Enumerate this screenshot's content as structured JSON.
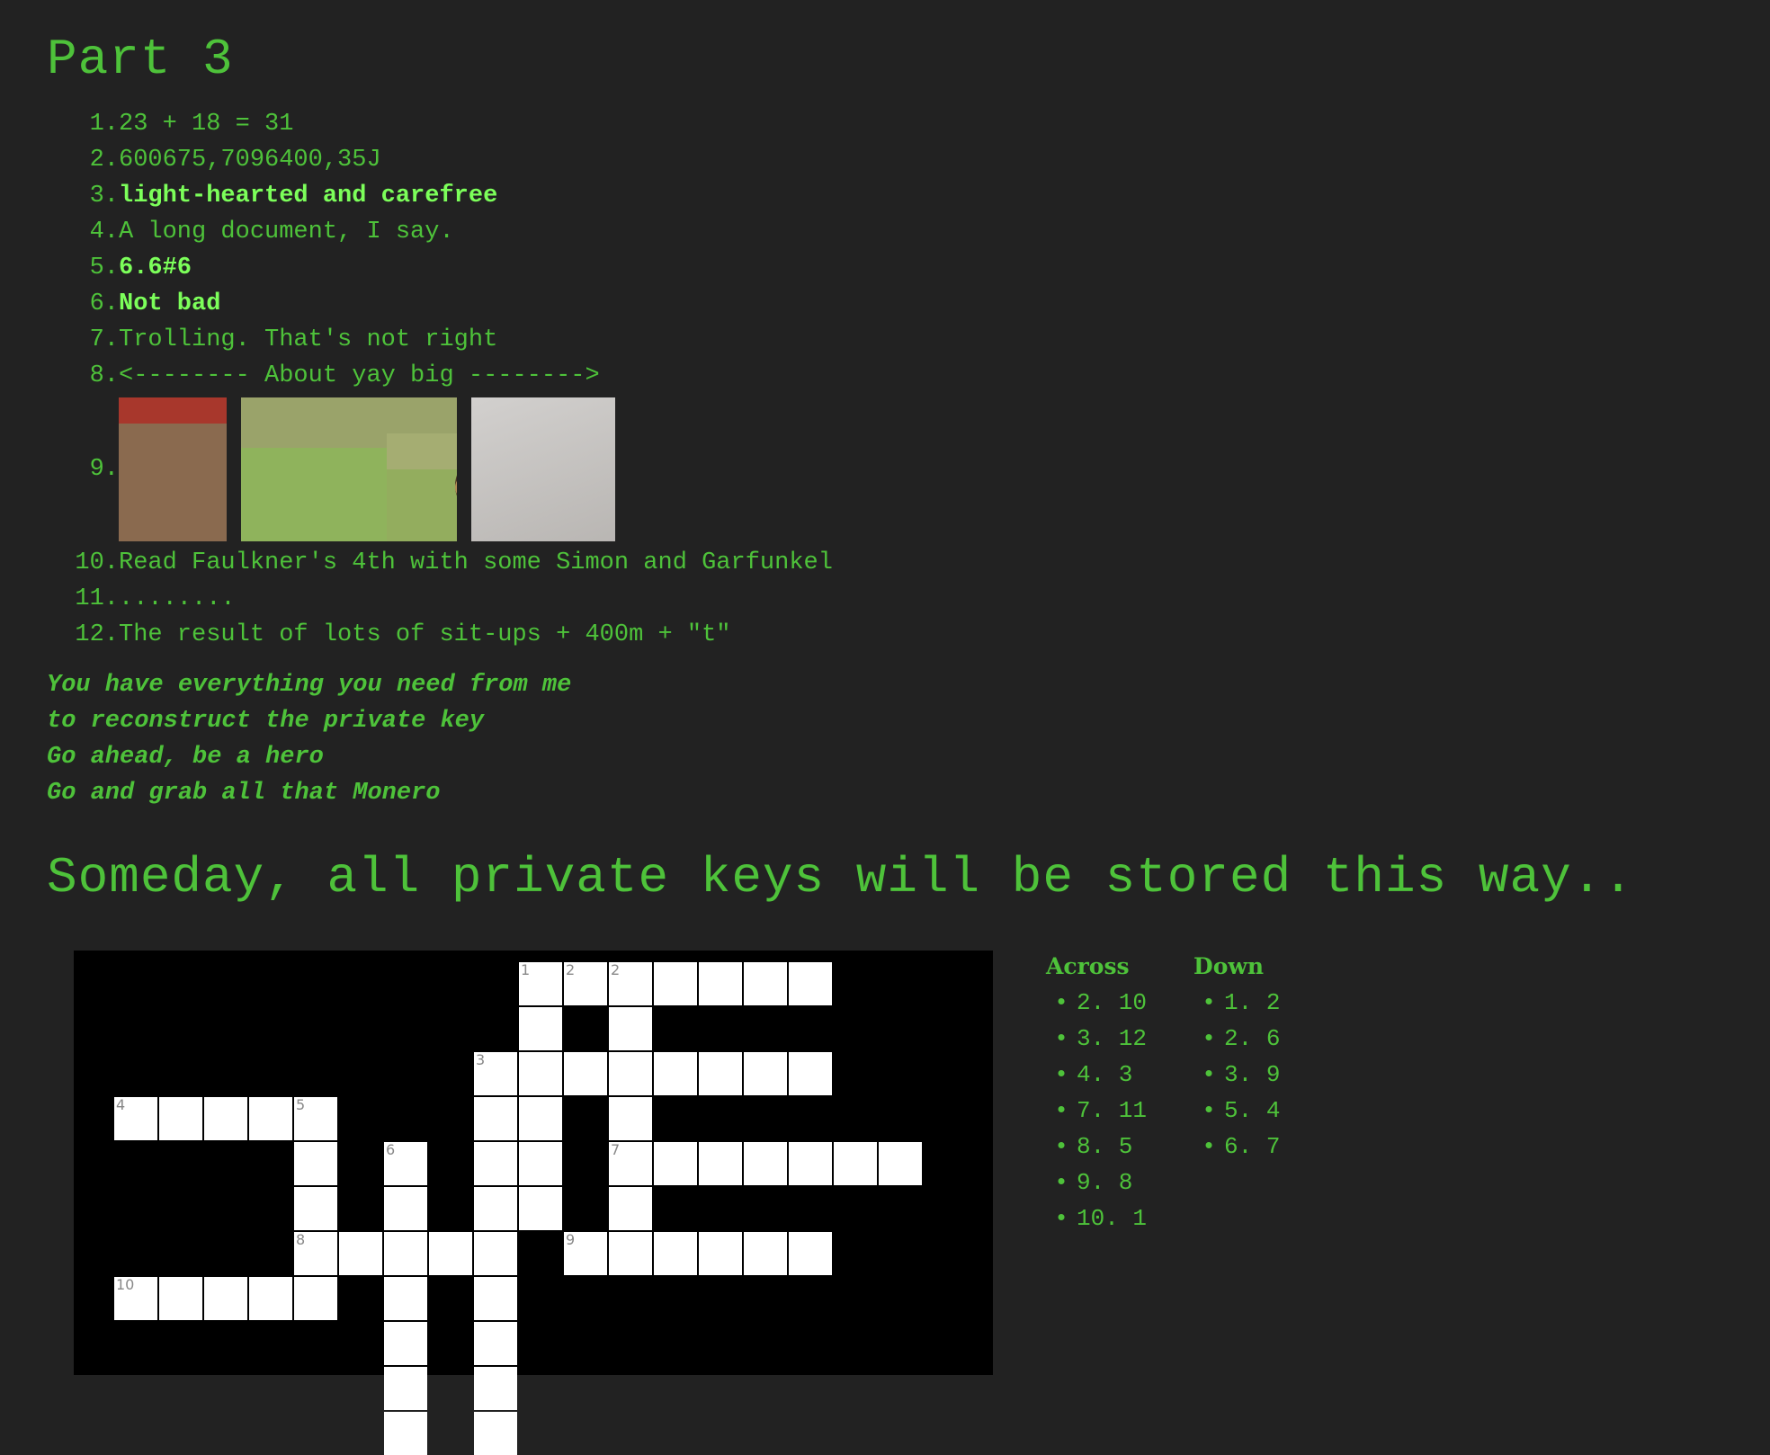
{
  "part_title": "Part 3",
  "clues": [
    {
      "num": "1.",
      "text": "23 + 18 = 31",
      "bright": false
    },
    {
      "num": "2.",
      "text": "600675,7096400,35J",
      "bright": false
    },
    {
      "num": "3.",
      "text": "light-hearted and carefree",
      "bright": true
    },
    {
      "num": "4.",
      "text": "A long document, I say.",
      "bright": false
    },
    {
      "num": "5.",
      "text": "6.6#6",
      "bright": true
    },
    {
      "num": "6.",
      "text": "Not bad",
      "bright": true
    },
    {
      "num": "7.",
      "text": "Trolling. That's not right",
      "bright": false
    },
    {
      "num": "8.",
      "text": "<-------- About yay big -------->",
      "bright": false
    },
    {
      "num": "9.",
      "images": [
        "person-with-hat-image",
        "lion-image",
        "raised-hand-image"
      ]
    },
    {
      "num": "10.",
      "text": "Read Faulkner's 4th with some Simon and Garfunkel",
      "bright": false
    },
    {
      "num": "11.",
      "text": "........",
      "bright": false
    },
    {
      "num": "12.",
      "text": "The result of lots of sit-ups + 400m + \"t\"",
      "bright": false
    }
  ],
  "poem": [
    "You have everything you need from me",
    "to reconstruct the private key",
    "Go ahead, be a hero",
    "Go and grab all that Monero"
  ],
  "headline": "Someday, all private keys will be stored this way..",
  "crossword": {
    "across_title": "Across",
    "down_title": "Down",
    "across": [
      "2. 10",
      "3. 12",
      "4. 3",
      "7. 11",
      "8. 5",
      "9. 8",
      "10. 1"
    ],
    "down": [
      "1. 2",
      "2. 6",
      "3. 9",
      "5. 4",
      "6. 7"
    ],
    "cell_numbers": [
      "1",
      "2",
      "3",
      "4",
      "5",
      "6",
      "7",
      "8",
      "9",
      "10"
    ]
  },
  "colors": {
    "background": "#222222",
    "text": "#4ec23a",
    "bright": "#7cff5a",
    "board": "#000000"
  }
}
